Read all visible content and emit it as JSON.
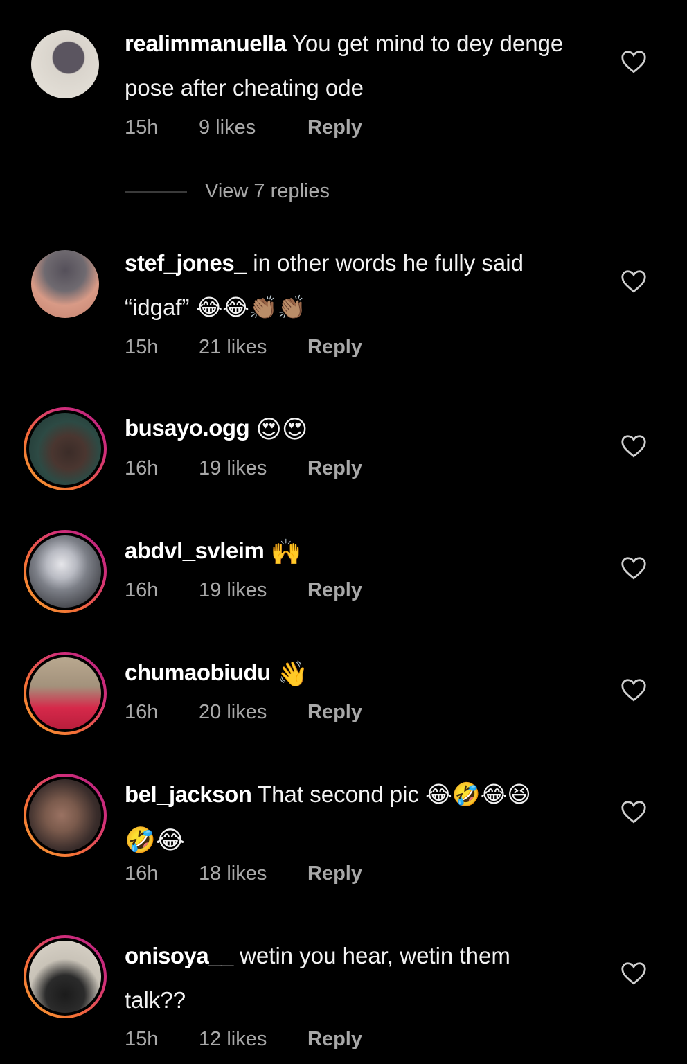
{
  "comments": [
    {
      "username": "realimmanuella",
      "text_line1": "You get mind to dey denge",
      "text_line2": "pose after cheating ode",
      "time": "15h",
      "likes": "9 likes",
      "reply": "Reply",
      "has_story_ring": false,
      "avatar_colors": [
        "#d9d4cc",
        "#5b5560"
      ]
    },
    {
      "username": "stef_jones_",
      "text_line1": "in other words he fully said",
      "text_line2": "“idgaf” 😂😂👏🏽👏🏽",
      "time": "15h",
      "likes": "21 likes",
      "reply": "Reply",
      "has_story_ring": false,
      "avatar_colors": [
        "#6f6a70",
        "#d89a86"
      ]
    },
    {
      "username": "busayo.ogg",
      "text_line1": "😍😍",
      "time": "16h",
      "likes": "19 likes",
      "reply": "Reply",
      "has_story_ring": true,
      "avatar_colors": [
        "#2d4a44",
        "#3b2c28"
      ]
    },
    {
      "username": "abdvl_svleim",
      "text_line1": "🙌",
      "time": "16h",
      "likes": "19 likes",
      "reply": "Reply",
      "has_story_ring": true,
      "avatar_colors": [
        "#7c7f87",
        "#1e1e22"
      ]
    },
    {
      "username": "chumaobiudu",
      "text_line1": "👋",
      "time": "16h",
      "likes": "20 likes",
      "reply": "Reply",
      "has_story_ring": true,
      "avatar_colors": [
        "#b9a88f",
        "#d6294a"
      ]
    },
    {
      "username": "bel_jackson",
      "text_line1": "That second pic 😂🤣😂😆",
      "text_line2": "🤣😂",
      "time": "16h",
      "likes": "18 likes",
      "reply": "Reply",
      "has_story_ring": true,
      "avatar_colors": [
        "#3a2d2b",
        "#7a5a4c"
      ]
    },
    {
      "username": "onisoya__",
      "text_line1": "wetin you hear, wetin them",
      "text_line2": "talk??",
      "time": "15h",
      "likes": "12 likes",
      "reply": "Reply",
      "has_story_ring": true,
      "avatar_colors": [
        "#c9c3b8",
        "#1b1b1b"
      ]
    }
  ],
  "view_replies": "View 7 replies",
  "colors": {
    "background": "#000000",
    "text": "#f2f2f2",
    "muted": "#a8a8a8",
    "ring_start": "#f7a531",
    "ring_end": "#b4217e"
  }
}
